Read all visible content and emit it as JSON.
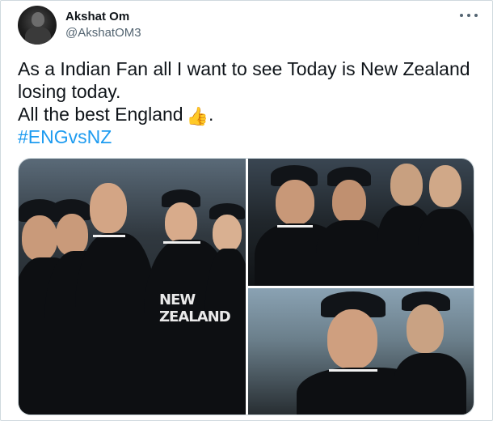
{
  "author": {
    "name": "Akshat Om",
    "handle": "@AkshatOM3",
    "avatar_icon": "profile-avatar"
  },
  "menu_icon": "more-options-icon",
  "tweet": {
    "line1": "As a Indian Fan all I want to see Today is New Zealand",
    "line2": "losing today.",
    "line3_text": "All the best England",
    "line3_emoji": "👍",
    "line3_end": ".",
    "hashtag": "#ENGvsNZ"
  },
  "media": {
    "count": 3,
    "photos": [
      {
        "name": "photo-team-lineup",
        "jersey_text": "NEW ZEALAND"
      },
      {
        "name": "photo-captain-thinking"
      },
      {
        "name": "photo-captain-cap"
      }
    ]
  },
  "colors": {
    "link": "#1d9bf0",
    "secondary_text": "#536471",
    "border": "#cfd9de"
  }
}
